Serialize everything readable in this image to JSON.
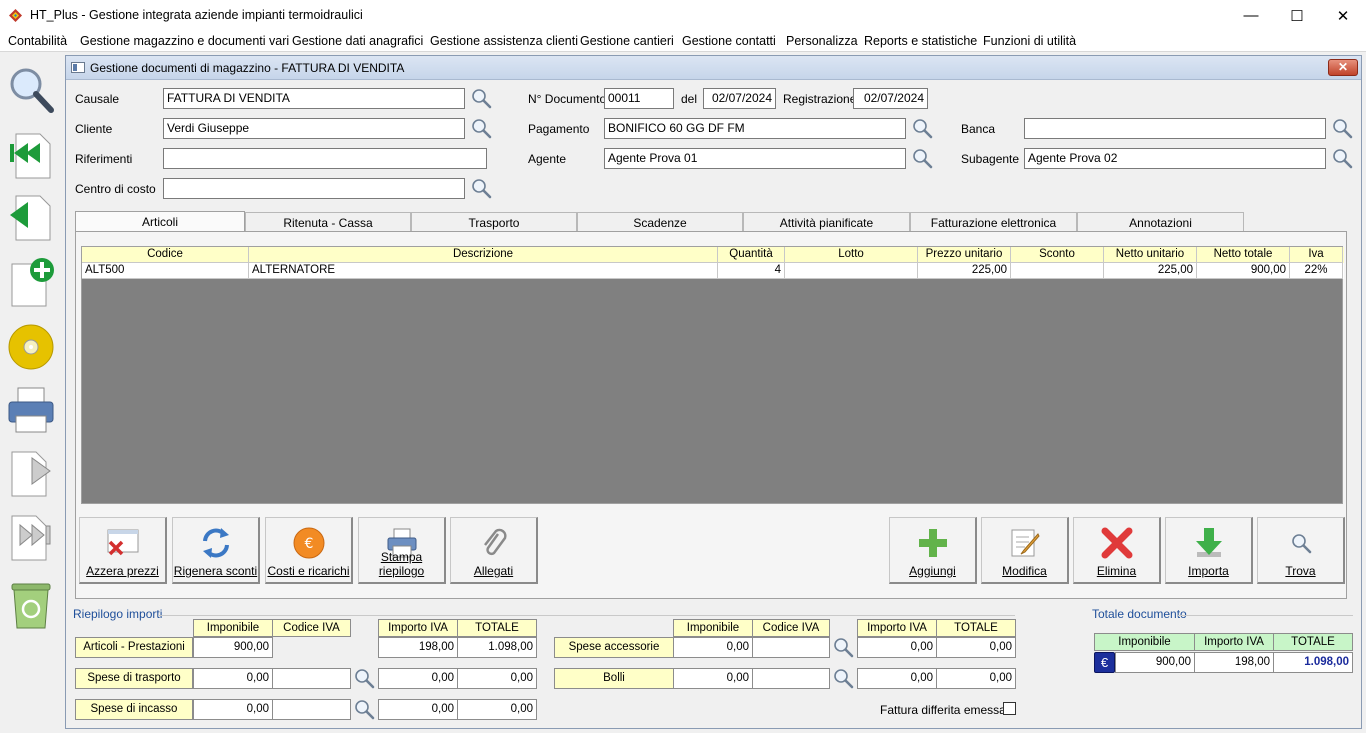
{
  "window": {
    "title": "HT_Plus - Gestione integrata aziende impianti termoidraulici",
    "min": "—",
    "max": "☐",
    "close": "✕"
  },
  "menu": [
    "Contabilità",
    "Gestione magazzino e documenti vari",
    "Gestione dati anagrafici",
    "Gestione assistenza clienti",
    "Gestione cantieri",
    "Gestione contatti",
    "Personalizza",
    "Reports e statistiche",
    "Funzioni di utilità"
  ],
  "form": {
    "title": "Gestione documenti di magazzino - FATTURA DI VENDITA",
    "close": "✕",
    "causale_label": "Causale",
    "causale": "FATTURA DI VENDITA",
    "cliente_label": "Cliente",
    "cliente": "Verdi Giuseppe",
    "riferimenti_label": "Riferimenti",
    "riferimenti": "",
    "centro_label": "Centro di costo",
    "centro": "",
    "ndoc_label": "N° Documento",
    "ndoc": "00011",
    "del_label": "del",
    "del": "02/07/2024",
    "reg_label": "Registrazione",
    "reg": "02/07/2024",
    "pagamento_label": "Pagamento",
    "pagamento": "BONIFICO 60 GG DF FM",
    "agente_label": "Agente",
    "agente": "Agente Prova 01",
    "banca_label": "Banca",
    "banca": "",
    "subagente_label": "Subagente",
    "subagente": "Agente Prova 02"
  },
  "tabs": [
    "Articoli",
    "Ritenuta - Cassa Previdenziale",
    "Trasporto",
    "Scadenze",
    "Attività pianificate",
    "Fatturazione elettronica",
    "Annotazioni"
  ],
  "grid": {
    "headers": [
      "Codice",
      "Descrizione",
      "Quantità",
      "Lotto",
      "Prezzo unitario",
      "Sconto",
      "Netto unitario",
      "Netto totale",
      "Iva"
    ],
    "rows": [
      [
        "ALT500",
        "ALTERNATORE",
        "4",
        "",
        "225,00",
        "",
        "225,00",
        "900,00",
        "22%"
      ]
    ]
  },
  "buttons_left": [
    "Azzera prezzi",
    "Rigenera sconti",
    "Costi e ricarichi",
    "Stampa riepilogo",
    "Allegati"
  ],
  "buttons_right": [
    "Aggiungi",
    "Modifica",
    "Elimina",
    "Importa",
    "Trova"
  ],
  "riepilogo": {
    "title": "Riepilogo importi",
    "h_imponibile": "Imponibile",
    "h_codiva": "Codice IVA",
    "h_importoiva": "Importo IVA",
    "h_totale": "TOTALE",
    "articoli": {
      "label": "Articoli - Prestazioni",
      "imponibile": "900,00",
      "codiva": "",
      "importoiva": "198,00",
      "totale": "1.098,00"
    },
    "trasporto": {
      "label": "Spese di trasporto",
      "imponibile": "0,00",
      "codiva": "",
      "importoiva": "0,00",
      "totale": "0,00"
    },
    "incasso": {
      "label": "Spese di incasso",
      "imponibile": "0,00",
      "codiva": "",
      "importoiva": "0,00",
      "totale": "0,00"
    },
    "accessorie": {
      "label": "Spese accessorie",
      "imponibile": "0,00",
      "codiva": "",
      "importoiva": "0,00",
      "totale": "0,00"
    },
    "bolli": {
      "label": "Bolli",
      "imponibile": "0,00",
      "codiva": "",
      "importoiva": "0,00",
      "totale": "0,00"
    },
    "differita_label": "Fattura differita emessa"
  },
  "totale": {
    "title": "Totale documento",
    "h_imponibile": "Imponibile",
    "h_importoiva": "Importo IVA",
    "h_totale": "TOTALE",
    "currency": "€",
    "imponibile": "900,00",
    "importoiva": "198,00",
    "totale": "1.098,00"
  }
}
